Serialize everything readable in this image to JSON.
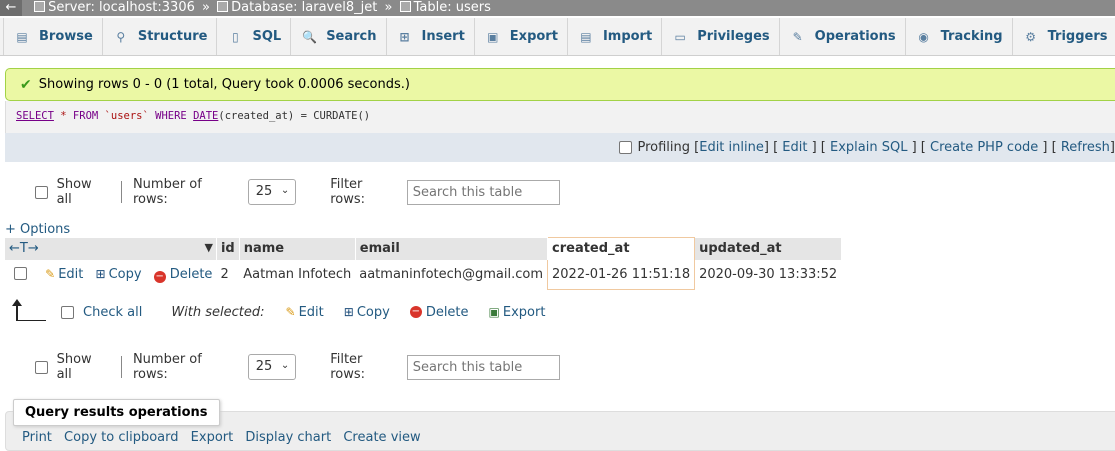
{
  "breadcrumb": {
    "back": "←",
    "server": "Server: localhost:3306",
    "database": "Database: laravel8_jet",
    "table": "Table: users",
    "sep": "»"
  },
  "tabs": [
    {
      "label": "Browse",
      "icon": "▤"
    },
    {
      "label": "Structure",
      "icon": "⚲"
    },
    {
      "label": "SQL",
      "icon": "▯"
    },
    {
      "label": "Search",
      "icon": "🔍"
    },
    {
      "label": "Insert",
      "icon": "⊞"
    },
    {
      "label": "Export",
      "icon": "▣"
    },
    {
      "label": "Import",
      "icon": "▤"
    },
    {
      "label": "Privileges",
      "icon": "▭"
    },
    {
      "label": "Operations",
      "icon": "✎"
    },
    {
      "label": "Tracking",
      "icon": "◉"
    },
    {
      "label": "Triggers",
      "icon": "⚙"
    }
  ],
  "success_message": "Showing rows 0 - 0 (1 total, Query took 0.0006 seconds.)",
  "sql": {
    "select": "SELECT",
    "star": "*",
    "from": "FROM",
    "table": "`users`",
    "where": "WHERE",
    "date_fn": "DATE",
    "arg": "(created_at)",
    "eq": "=",
    "curdate": "CURDATE()"
  },
  "profiling": {
    "label": "Profiling",
    "links": [
      "Edit inline",
      "Edit",
      "Explain SQL",
      "Create PHP code",
      "Refresh"
    ]
  },
  "nav": {
    "show_all": "Show all",
    "num_rows_label": "Number of rows:",
    "num_rows_value": "25",
    "filter_label": "Filter rows:",
    "filter_placeholder": "Search this table"
  },
  "options_link": "+ Options",
  "table": {
    "arrows": "←T→",
    "columns": [
      "id",
      "name",
      "email",
      "created_at",
      "updated_at"
    ],
    "row_actions": {
      "edit": "Edit",
      "copy": "Copy",
      "delete": "Delete"
    },
    "rows": [
      {
        "id": "2",
        "name": "Aatman Infotech",
        "email": "aatmaninfotech@gmail.com",
        "created_at": "2022-01-26 11:51:18",
        "updated_at": "2020-09-30 13:33:52"
      }
    ]
  },
  "bulk": {
    "check_all": "Check all",
    "with_selected": "With selected:",
    "edit": "Edit",
    "copy": "Copy",
    "delete": "Delete",
    "export": "Export"
  },
  "query_results": {
    "legend": "Query results operations",
    "links": [
      "Print",
      "Copy to clipboard",
      "Export",
      "Display chart",
      "Create view"
    ]
  }
}
